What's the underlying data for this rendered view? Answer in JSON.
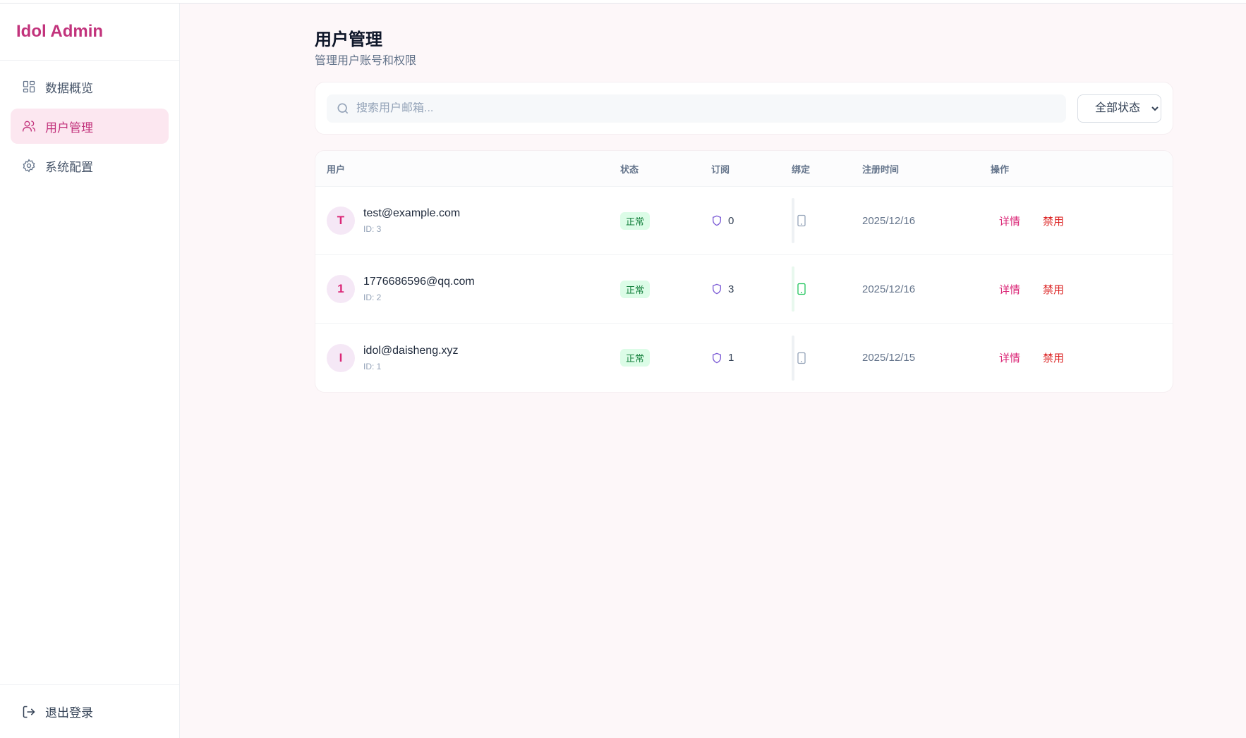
{
  "brand": {
    "title": "Idol Admin",
    "color": "#c2337c"
  },
  "sidebar": {
    "items": [
      {
        "label": "数据概览",
        "icon": "dashboard-icon",
        "active": false
      },
      {
        "label": "用户管理",
        "icon": "users-icon",
        "active": true
      },
      {
        "label": "系统配置",
        "icon": "gear-icon",
        "active": false
      }
    ],
    "logout": {
      "label": "退出登录",
      "icon": "logout-icon"
    }
  },
  "page": {
    "title": "用户管理",
    "subtitle": "管理用户账号和权限"
  },
  "filters": {
    "search_placeholder": "搜索用户邮箱...",
    "status_selected": "全部状态"
  },
  "table": {
    "headers": {
      "user": "用户",
      "status": "状态",
      "subscription": "订阅",
      "binding": "绑定",
      "registered": "注册时间",
      "actions": "操作"
    },
    "rows": [
      {
        "avatar": "T",
        "email": "test@example.com",
        "id": "ID: 3",
        "status": "正常",
        "subscriptions": "0",
        "bound": false,
        "registered": "2025/12/16",
        "detail": "详情",
        "disable": "禁用"
      },
      {
        "avatar": "1",
        "email": "1776686596@qq.com",
        "id": "ID: 2",
        "status": "正常",
        "subscriptions": "3",
        "bound": true,
        "registered": "2025/12/16",
        "detail": "详情",
        "disable": "禁用"
      },
      {
        "avatar": "I",
        "email": "idol@daisheng.xyz",
        "id": "ID: 1",
        "status": "正常",
        "subscriptions": "1",
        "bound": false,
        "registered": "2025/12/15",
        "detail": "详情",
        "disable": "禁用"
      }
    ]
  },
  "colors": {
    "accent": "#db2777",
    "danger": "#dc2626",
    "success": "#15803d",
    "bound_device": "#22c55e",
    "unbound_device": "#94a3b8",
    "shield": "#7c5cd6"
  }
}
